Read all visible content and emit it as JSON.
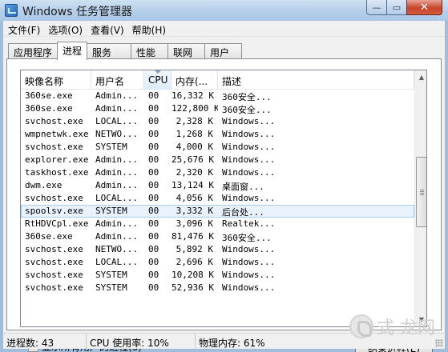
{
  "window": {
    "title": "Windows 任务管理器",
    "min_symbol": "—",
    "max_symbol": "▭",
    "close_symbol": "✕"
  },
  "menu": [
    "文件(F)",
    "选项(O)",
    "查看(V)",
    "帮助(H)"
  ],
  "tabs": [
    "应用程序",
    "进程",
    "服务",
    "性能",
    "联网",
    "用户"
  ],
  "active_tab": "进程",
  "columns": [
    "映像名称",
    "用户名",
    "CPU",
    "内存(...",
    "描述"
  ],
  "sorted_column": "CPU",
  "rows": [
    [
      "360se.exe",
      "Admin...",
      "00",
      "16,332 K",
      "360安全..."
    ],
    [
      "360se.exe",
      "Admin...",
      "00",
      "122,800 K",
      "360安全..."
    ],
    [
      "svchost.exe",
      "LOCAL...",
      "00",
      "2,328 K",
      "Windows..."
    ],
    [
      "wmpnetwk.exe",
      "NETWO...",
      "00",
      "1,268 K",
      "Windows..."
    ],
    [
      "svchost.exe",
      "SYSTEM",
      "00",
      "4,000 K",
      "Windows..."
    ],
    [
      "explorer.exe",
      "Admin...",
      "00",
      "25,676 K",
      "Windows..."
    ],
    [
      "taskhost.exe",
      "Admin...",
      "00",
      "2,320 K",
      "Windows..."
    ],
    [
      "dwm.exe",
      "Admin...",
      "00",
      "13,124 K",
      "桌面窗..."
    ],
    [
      "svchost.exe",
      "LOCAL...",
      "00",
      "4,056 K",
      "Windows..."
    ],
    [
      "spoolsv.exe",
      "SYSTEM",
      "00",
      "3,332 K",
      "后台处..."
    ],
    [
      "RtHDVCpl.exe",
      "Admin...",
      "00",
      "3,096 K",
      "Realtek..."
    ],
    [
      "360se.exe",
      "Admin...",
      "00",
      "81,476 K",
      "360安全..."
    ],
    [
      "svchost.exe",
      "NETWO...",
      "00",
      "5,892 K",
      "Windows..."
    ],
    [
      "svchost.exe",
      "LOCAL...",
      "00",
      "2,696 K",
      "Windows..."
    ],
    [
      "svchost.exe",
      "SYSTEM",
      "00",
      "10,208 K",
      "Windows..."
    ],
    [
      "svchost.exe",
      "SYSTEM",
      "00",
      "52,936 K",
      "Windows..."
    ]
  ],
  "selected_row": 9,
  "show_all_users_label": "显示所有用户的进程(S)",
  "show_all_users_checked": true,
  "end_process_label": "结束进程(E)",
  "status": {
    "processes": "进程数: 43",
    "cpu": "CPU 使用率: 10%",
    "memory": "物理内存: 61%"
  },
  "watermark": "式 龙网"
}
